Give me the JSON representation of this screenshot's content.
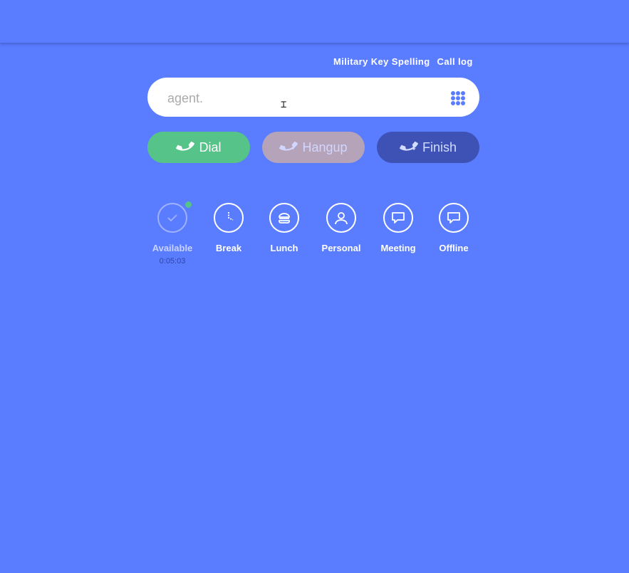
{
  "header": {
    "links": [
      "Military Key Spelling",
      "Call log"
    ]
  },
  "search": {
    "value": "agent.",
    "icon": "keypad-icon"
  },
  "actions": {
    "dial_label": "Dial",
    "hangup_label": "Hangup",
    "finish_label": "Finish"
  },
  "statuses": {
    "available": {
      "label": "Available",
      "timer": "0:05:03",
      "icon": "check-icon"
    },
    "break": {
      "label": "Break",
      "icon": "clock-icon"
    },
    "lunch": {
      "label": "Lunch",
      "icon": "burger-icon"
    },
    "personal": {
      "label": "Personal",
      "icon": "person-icon"
    },
    "meeting": {
      "label": "Meeting",
      "icon": "chat-icon"
    },
    "offline": {
      "label": "Offline",
      "icon": "chat-icon"
    }
  },
  "colors": {
    "background": "#5a7cff",
    "dial": "#56c489",
    "hangup": "#b5a3b9",
    "finish": "#3e52b5"
  }
}
